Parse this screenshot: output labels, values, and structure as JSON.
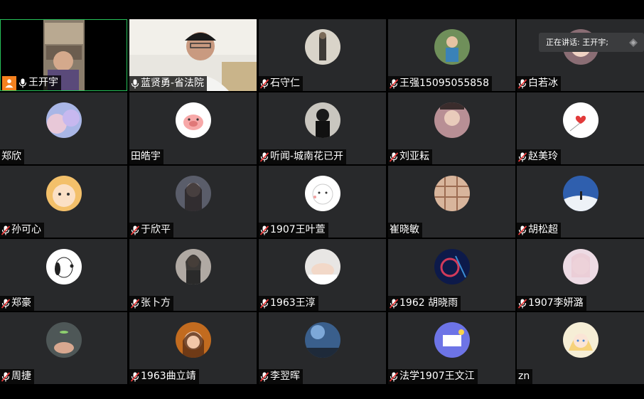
{
  "speaking_indicator": "正在讲话: 王开宇;",
  "participants": [
    {
      "name": "王开宇",
      "mic": "on",
      "host": true,
      "video": true,
      "avatar": "video-self"
    },
    {
      "name": "蓝贤勇-省法院",
      "mic": "on",
      "video": true,
      "avatar": "video-man"
    },
    {
      "name": "石守仁",
      "mic": "muted",
      "avatar": "figure-avatar"
    },
    {
      "name": "王强15095055858",
      "mic": "muted",
      "avatar": "child-photo-avatar"
    },
    {
      "name": "白若冰",
      "mic": "muted",
      "avatar": "anime-avatar"
    },
    {
      "name": "郑欣",
      "mic": "none",
      "avatar": "sky-avatar"
    },
    {
      "name": "田皓宇",
      "mic": "none",
      "avatar": "pig-avatar"
    },
    {
      "name": "听闻-城南花已开",
      "mic": "muted",
      "avatar": "girl-dark-avatar"
    },
    {
      "name": "刘亚耘",
      "mic": "muted",
      "avatar": "girl-photo-avatar"
    },
    {
      "name": "赵美玲",
      "mic": "muted",
      "avatar": "heart-avatar"
    },
    {
      "name": "孙可心",
      "mic": "muted",
      "avatar": "cartoon-face-avatar"
    },
    {
      "name": "于欣平",
      "mic": "muted",
      "avatar": "dark-hair-avatar"
    },
    {
      "name": "1907王叶萱",
      "mic": "muted",
      "avatar": "white-blob-avatar"
    },
    {
      "name": "崔晓敏",
      "mic": "none",
      "avatar": "plaid-avatar"
    },
    {
      "name": "胡松超",
      "mic": "muted",
      "avatar": "cloud-avatar"
    },
    {
      "name": "郑豪",
      "mic": "muted",
      "avatar": "snoopy-avatar"
    },
    {
      "name": "张卜方",
      "mic": "muted",
      "avatar": "woman-avatar"
    },
    {
      "name": "1963王淳",
      "mic": "muted",
      "avatar": "sleeping-avatar"
    },
    {
      "name": "1962  胡晓雨",
      "mic": "muted",
      "avatar": "neon-avatar"
    },
    {
      "name": "1907李妍潞",
      "mic": "muted",
      "avatar": "pastel-avatar"
    },
    {
      "name": "周捷",
      "mic": "muted",
      "avatar": "hand-avatar"
    },
    {
      "name": "1963曲立靖",
      "mic": "muted",
      "avatar": "cartoon-girl-avatar"
    },
    {
      "name": "李翌晖",
      "mic": "muted",
      "avatar": "night-sky-avatar"
    },
    {
      "name": "法学1907王文江",
      "mic": "muted",
      "avatar": "illustration-avatar"
    },
    {
      "name": "zn",
      "mic": "none",
      "avatar": "blonde-anime-avatar"
    }
  ]
}
